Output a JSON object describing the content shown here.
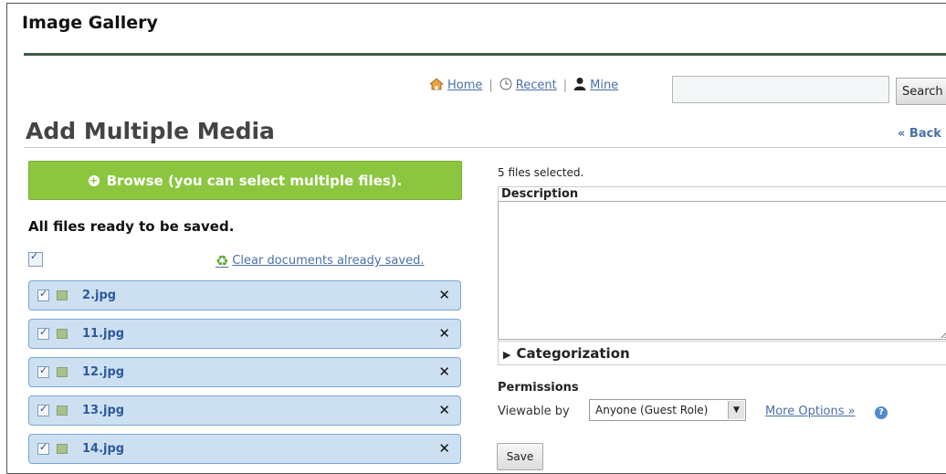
{
  "header": {
    "gallery_title": "Image Gallery",
    "nav": {
      "home": "Home",
      "recent": "Recent",
      "mine": "Mine"
    },
    "search_button": "Search",
    "search_value": ""
  },
  "page": {
    "title": "Add Multiple Media",
    "back_link": "« Back"
  },
  "uploader": {
    "browse_label": "Browse (you can select multiple files).",
    "status": "All files ready to be saved.",
    "clear_link": "Clear documents already saved.",
    "files": [
      {
        "name": "2.jpg",
        "checked": true
      },
      {
        "name": "11.jpg",
        "checked": true
      },
      {
        "name": "12.jpg",
        "checked": true
      },
      {
        "name": "13.jpg",
        "checked": true
      },
      {
        "name": "14.jpg",
        "checked": true
      }
    ]
  },
  "details": {
    "selected_count": "5 files selected.",
    "description_label": "Description",
    "description_value": "",
    "categorization_label": "Categorization",
    "permissions_label": "Permissions",
    "viewable_label": "Viewable by",
    "viewable_value": "Anyone (Guest Role)",
    "more_options": "More Options »",
    "save_label": "Save"
  },
  "colors": {
    "browse_green": "#8cc63f",
    "file_row_bg": "#cde0f2",
    "link_blue": "#4a70a8",
    "header_rule": "#3f5b4b"
  },
  "icons": [
    "home-icon",
    "clock-icon",
    "user-icon",
    "plus-circle-icon",
    "recycle-icon",
    "checkbox-icon",
    "image-thumb-icon",
    "close-icon",
    "disclosure-triangle-icon",
    "dropdown-arrow-icon",
    "help-icon"
  ]
}
